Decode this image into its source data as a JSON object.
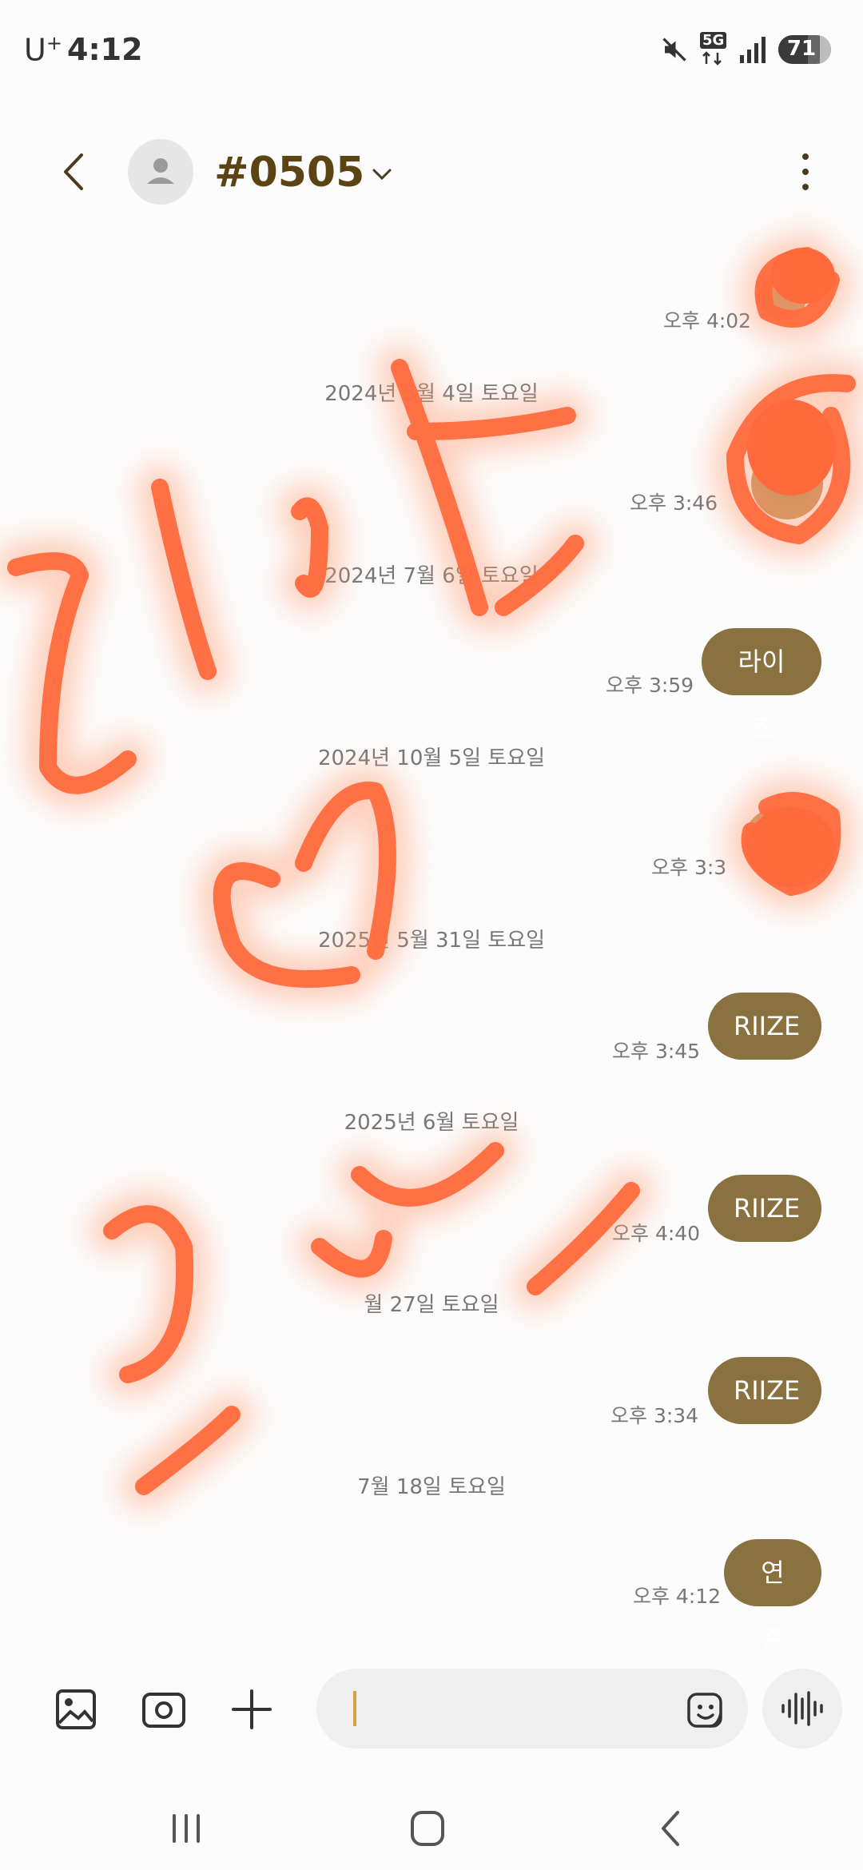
{
  "status_bar": {
    "carrier": "U",
    "carrier_suffix": "+",
    "time": "4:12",
    "network": "5G",
    "battery": "71",
    "battery_level_percent": 71
  },
  "header": {
    "contact_name": "#0505"
  },
  "messages": [
    {
      "type": "sticker",
      "time": "오후 4:02"
    },
    {
      "type": "date",
      "text": "2024년 5월 4일 토요일"
    },
    {
      "type": "sticker",
      "time": "오후 3:46"
    },
    {
      "type": "date",
      "text": "2024년 7월 6일 토요일"
    },
    {
      "type": "bubble",
      "text": "라이즈",
      "time": "오후 3:59"
    },
    {
      "type": "date",
      "text": "2024년 10월 5일 토요일"
    },
    {
      "type": "sticker",
      "time": "오후 3:3"
    },
    {
      "type": "date",
      "text": "2025년 5월 31일 토요일"
    },
    {
      "type": "bubble",
      "text": "RIIZE",
      "time": "오후 3:45"
    },
    {
      "type": "date",
      "text": "2025년 6월 토요일"
    },
    {
      "type": "bubble",
      "text": "RIIZE",
      "time": "오후 4:40"
    },
    {
      "type": "date",
      "text": "월 27일 토요일"
    },
    {
      "type": "bubble",
      "text": "RIIZE",
      "time": "오후 3:34"
    },
    {
      "type": "date",
      "text": "7월 18일 토요일"
    },
    {
      "type": "bubble",
      "text": "연준",
      "time": "오후 4:12"
    }
  ],
  "colors": {
    "accent": "#8a7140",
    "name": "#5c4314",
    "doodle": "#ff6a3d"
  }
}
